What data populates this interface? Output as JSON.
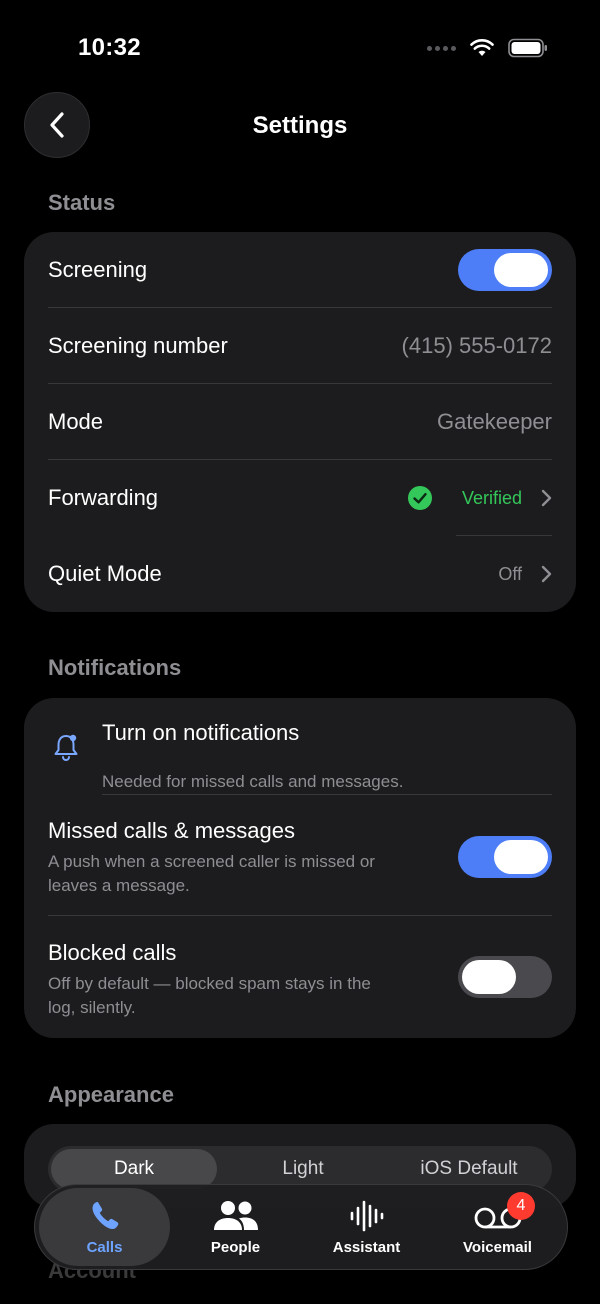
{
  "status_bar": {
    "time": "10:32"
  },
  "nav": {
    "title": "Settings"
  },
  "status_section": {
    "heading": "Status",
    "screening": {
      "label": "Screening",
      "on": true
    },
    "screening_number": {
      "label": "Screening number",
      "value": "(415) 555-0172"
    },
    "mode": {
      "label": "Mode",
      "value": "Gatekeeper"
    },
    "forwarding": {
      "label": "Forwarding",
      "value": "Verified"
    },
    "quiet_mode": {
      "label": "Quiet Mode",
      "value": "Off"
    }
  },
  "notifications_section": {
    "heading": "Notifications",
    "turn_on": {
      "title": "Turn on notifications",
      "subtitle": "Needed for missed calls and messages."
    },
    "missed": {
      "title": "Missed calls & messages",
      "line1": "A push when a screened caller is missed or",
      "line2": "leaves a message.",
      "on": true
    },
    "blocked": {
      "title": "Blocked calls",
      "line1": "Off by default — blocked spam stays in the",
      "line2": "log, silently.",
      "on": false
    }
  },
  "appearance_section": {
    "heading": "Appearance",
    "options": [
      "Dark",
      "Light",
      "iOS Default"
    ],
    "selected": "Dark"
  },
  "next_heading": "Account",
  "tabbar": {
    "tabs": [
      {
        "label": "Calls",
        "icon": "phone-icon",
        "active": true
      },
      {
        "label": "People",
        "icon": "people-icon",
        "active": false
      },
      {
        "label": "Assistant",
        "icon": "waveform-icon",
        "active": false
      },
      {
        "label": "Voicemail",
        "icon": "voicemail-icon",
        "active": false,
        "badge": "4"
      }
    ]
  },
  "colors": {
    "accent": "#4d7ef7",
    "verified": "#34c759",
    "badge": "#ff3b30",
    "active_tab": "#6ea3ff"
  }
}
